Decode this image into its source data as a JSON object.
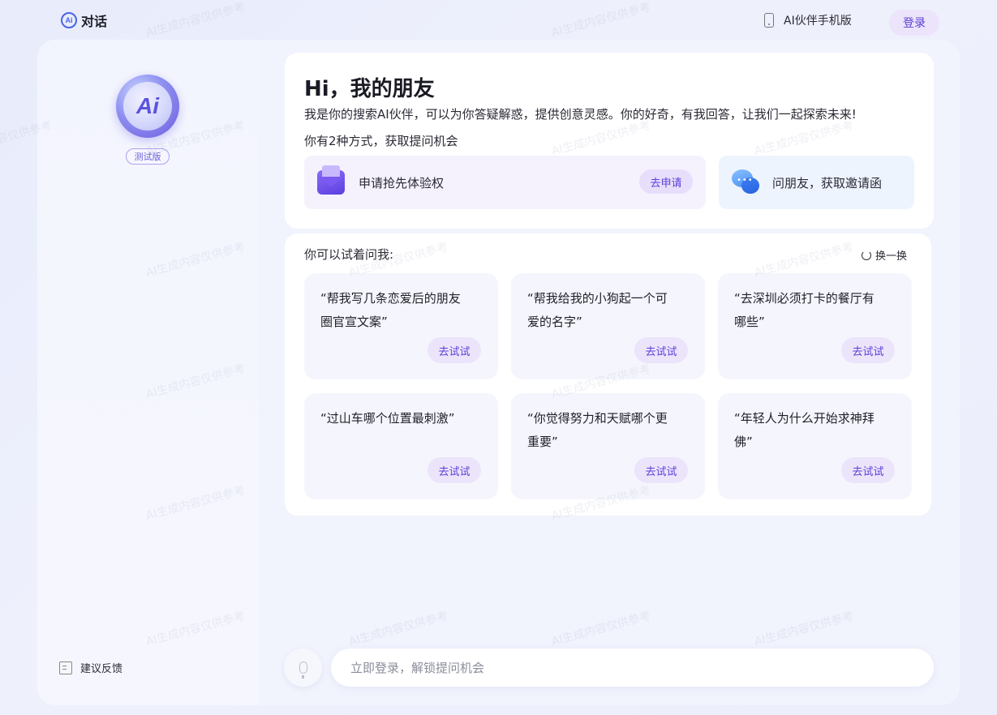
{
  "topbar": {
    "brand_logo_text": "Ai",
    "brand_title": "对话",
    "mobile_label": "AI伙伴手机版",
    "login_label": "登录"
  },
  "sidebar": {
    "avatar_text": "Ai",
    "beta_badge": "测试版",
    "feedback_label": "建议反馈"
  },
  "welcome": {
    "title": "Hi，我的朋友",
    "intro": "我是你的搜索AI伙伴，可以为你答疑解惑，提供创意灵感。你的好奇，有我回答，让我们一起探索未来!",
    "ways": "你有2种方式，获取提问机会",
    "apply": {
      "label": "申请抢先体验权",
      "button": "去申请"
    },
    "friend": {
      "label": "问朋友，获取邀请函"
    }
  },
  "suggestions": {
    "title": "你可以试着问我:",
    "refresh_label": "换一换",
    "try_label": "去试试",
    "items": [
      {
        "text": "“帮我写几条恋爱后的朋友圈官宣文案”"
      },
      {
        "text": "“帮我给我的小狗起一个可爱的名字”"
      },
      {
        "text": "“去深圳必须打卡的餐厅有哪些”"
      },
      {
        "text": "“过山车哪个位置最刺激”"
      },
      {
        "text": "“你觉得努力和天赋哪个更重要”"
      },
      {
        "text": "“年轻人为什么开始求神拜佛”"
      }
    ]
  },
  "composer": {
    "placeholder": "立即登录，解锁提问机会"
  },
  "watermark": {
    "text": "AI生成内容仅供参考"
  },
  "colors": {
    "accent": "#5b3fd6",
    "brand_blue": "#4a63e8",
    "page_bg": "#e8ecfb",
    "card_bg": "#ffffff"
  }
}
